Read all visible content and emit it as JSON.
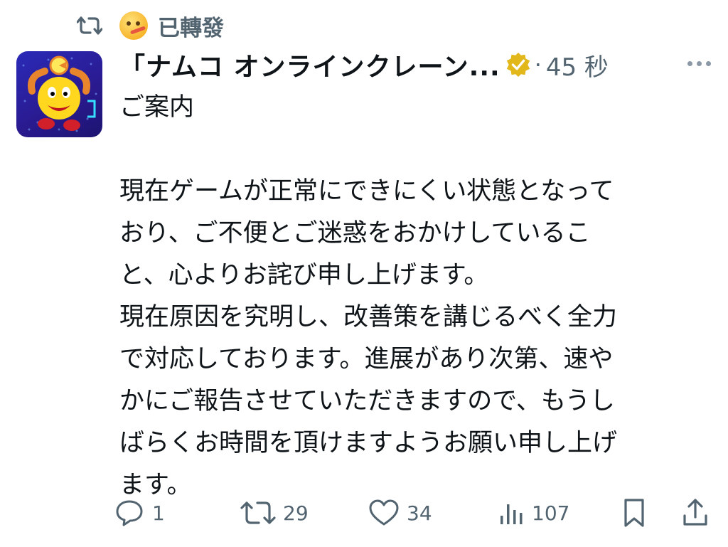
{
  "retweet": {
    "icon": "retweet-icon",
    "emoji": "face-with-thermometer-emoji",
    "label": "已轉發"
  },
  "tweet": {
    "author_name": "「ナムコ オンラインクレーン...",
    "verified_badge": "verified-badge-icon",
    "separator": "·",
    "time": "45 秒",
    "more": "more-icon",
    "body_lines": [
      "ご案内",
      "",
      "現在ゲームが正常にできにくい状態となって",
      "おり、ご不便とご迷惑をおかけしているこ",
      "と、心よりお詫び申し上げます。",
      "現在原因を究明し、改善策を講じるべく全力",
      "で対応しております。進展があり次第、速や",
      "かにご報告させていただきますので、もうし",
      "ばらくお時間を頂けますようお願い申し上げ",
      "ます。"
    ]
  },
  "actions": {
    "reply": {
      "icon": "reply-icon",
      "count": "1"
    },
    "retweet": {
      "icon": "retweet-icon",
      "count": "29"
    },
    "like": {
      "icon": "heart-icon",
      "count": "34"
    },
    "views": {
      "icon": "views-icon",
      "count": "107"
    },
    "bookmark": {
      "icon": "bookmark-icon"
    },
    "share": {
      "icon": "share-icon"
    }
  },
  "colors": {
    "text": "#0f1419",
    "secondary": "#536471",
    "verified_gold": "#e2b719",
    "avatar_bg": "#2a2ab8"
  }
}
